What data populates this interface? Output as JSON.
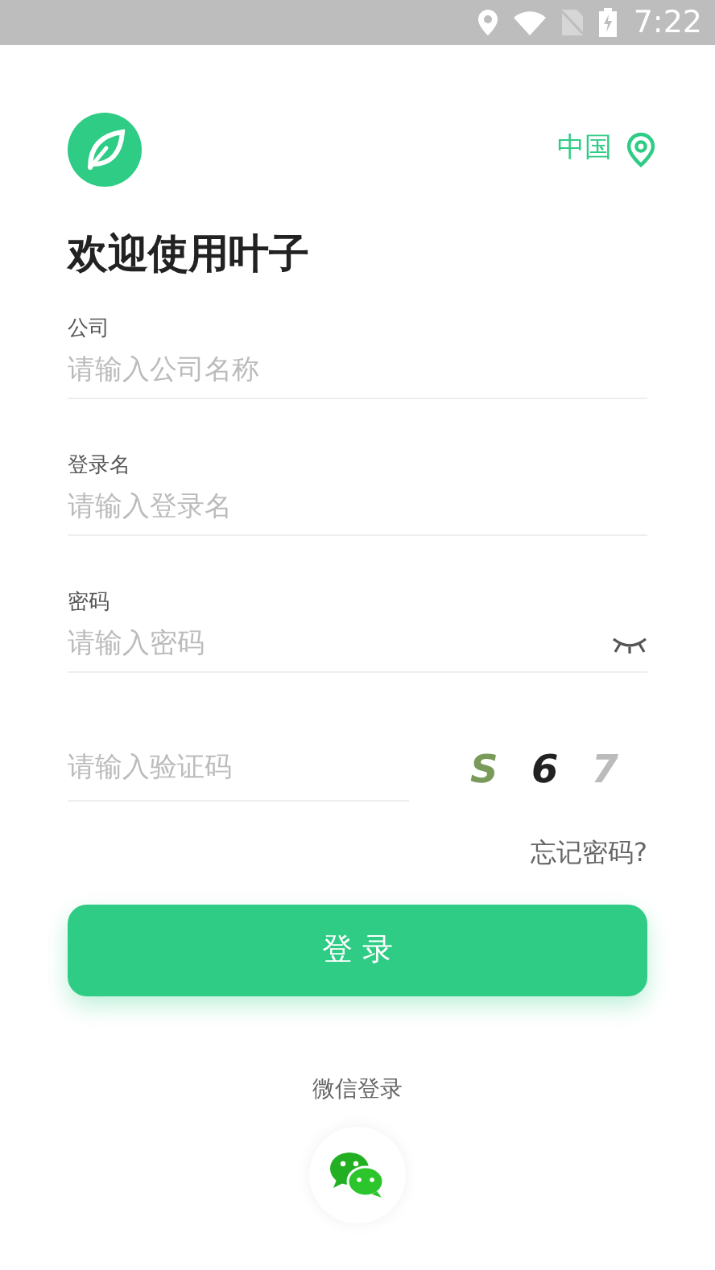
{
  "status_bar": {
    "time": "7:22"
  },
  "header": {
    "region": "中国"
  },
  "title": "欢迎使用叶子",
  "fields": [
    {
      "label": "公司",
      "placeholder": "请输入公司名称",
      "kind": "text"
    },
    {
      "label": "登录名",
      "placeholder": "请输入登录名",
      "kind": "text"
    },
    {
      "label": "密码",
      "placeholder": "请输入密码",
      "kind": "password"
    }
  ],
  "captcha": {
    "placeholder": "请输入验证码",
    "chars": [
      {
        "char": "S",
        "color": "#7a9a5a"
      },
      {
        "char": "6",
        "color": "#222222"
      },
      {
        "char": "7",
        "color": "#bbbbbb"
      }
    ]
  },
  "forgot_link": "忘记密码?",
  "login_button": "登 录",
  "wechat_label": "微信登录"
}
